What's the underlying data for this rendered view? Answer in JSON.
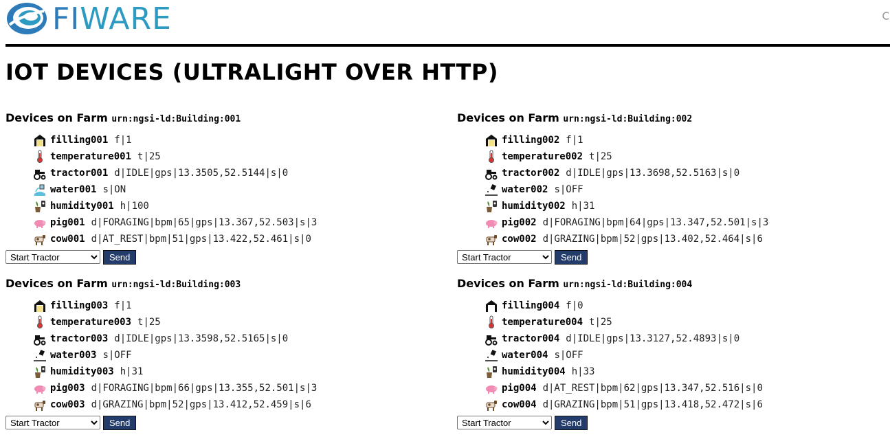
{
  "brand": {
    "text_start": "FI",
    "text_end": "WARE",
    "primary_color": "#2d7bb9",
    "accent_color": "#2d9ac1"
  },
  "page": {
    "title": "IOT DEVICES (ULTRALIGHT OVER HTTP)"
  },
  "farms": [
    {
      "title_prefix": "Devices on Farm",
      "urn": "urn:ngsi-ld:Building:001",
      "devices": [
        {
          "icon": "filling-barn-icon",
          "name": "filling001",
          "payload": "f|1"
        },
        {
          "icon": "thermometer-icon",
          "name": "temperature001",
          "payload": "t|25"
        },
        {
          "icon": "tractor-icon",
          "name": "tractor001",
          "payload": "d|IDLE|gps|13.3505,52.5144|s|0"
        },
        {
          "icon": "water-on-icon",
          "name": "water001",
          "payload": "s|ON"
        },
        {
          "icon": "humidity-plant-icon",
          "name": "humidity001",
          "payload": "h|100"
        },
        {
          "icon": "pig-icon",
          "name": "pig001",
          "payload": "d|FORAGING|bpm|65|gps|13.367,52.503|s|3"
        },
        {
          "icon": "cow-icon",
          "name": "cow001",
          "payload": "d|AT_REST|bpm|51|gps|13.422,52.461|s|0"
        }
      ],
      "command": {
        "selected": "Start Tractor",
        "send_label": "Send"
      }
    },
    {
      "title_prefix": "Devices on Farm",
      "urn": "urn:ngsi-ld:Building:002",
      "devices": [
        {
          "icon": "filling-barn-icon",
          "name": "filling002",
          "payload": "f|1"
        },
        {
          "icon": "thermometer-icon",
          "name": "temperature002",
          "payload": "t|25"
        },
        {
          "icon": "tractor-icon",
          "name": "tractor002",
          "payload": "d|IDLE|gps|13.3698,52.5163|s|0"
        },
        {
          "icon": "water-off-icon",
          "name": "water002",
          "payload": "s|OFF"
        },
        {
          "icon": "humidity-plant-icon",
          "name": "humidity002",
          "payload": "h|31"
        },
        {
          "icon": "pig-icon",
          "name": "pig002",
          "payload": "d|FORAGING|bpm|64|gps|13.347,52.501|s|3"
        },
        {
          "icon": "cow-icon",
          "name": "cow002",
          "payload": "d|GRAZING|bpm|52|gps|13.402,52.464|s|6"
        }
      ],
      "command": {
        "selected": "Start Tractor",
        "send_label": "Send"
      }
    },
    {
      "title_prefix": "Devices on Farm",
      "urn": "urn:ngsi-ld:Building:003",
      "devices": [
        {
          "icon": "filling-barn-icon",
          "name": "filling003",
          "payload": "f|1"
        },
        {
          "icon": "thermometer-icon",
          "name": "temperature003",
          "payload": "t|25"
        },
        {
          "icon": "tractor-icon",
          "name": "tractor003",
          "payload": "d|IDLE|gps|13.3598,52.5165|s|0"
        },
        {
          "icon": "water-off-icon",
          "name": "water003",
          "payload": "s|OFF"
        },
        {
          "icon": "humidity-plant-icon",
          "name": "humidity003",
          "payload": "h|31"
        },
        {
          "icon": "pig-icon",
          "name": "pig003",
          "payload": "d|FORAGING|bpm|66|gps|13.355,52.501|s|3"
        },
        {
          "icon": "cow-icon",
          "name": "cow003",
          "payload": "d|GRAZING|bpm|52|gps|13.412,52.459|s|6"
        }
      ],
      "command": {
        "selected": "Start Tractor",
        "send_label": "Send"
      }
    },
    {
      "title_prefix": "Devices on Farm",
      "urn": "urn:ngsi-ld:Building:004",
      "devices": [
        {
          "icon": "empty-barn-icon",
          "name": "filling004",
          "payload": "f|0"
        },
        {
          "icon": "thermometer-icon",
          "name": "temperature004",
          "payload": "t|25"
        },
        {
          "icon": "tractor-icon",
          "name": "tractor004",
          "payload": "d|IDLE|gps|13.3127,52.4893|s|0"
        },
        {
          "icon": "water-off-icon",
          "name": "water004",
          "payload": "s|OFF"
        },
        {
          "icon": "humidity-plant-icon",
          "name": "humidity004",
          "payload": "h|33"
        },
        {
          "icon": "pig-icon",
          "name": "pig004",
          "payload": "d|AT_REST|bpm|62|gps|13.347,52.516|s|0"
        },
        {
          "icon": "cow-icon",
          "name": "cow004",
          "payload": "d|GRAZING|bpm|51|gps|13.418,52.472|s|6"
        }
      ],
      "command": {
        "selected": "Start Tractor",
        "send_label": "Send"
      }
    }
  ]
}
